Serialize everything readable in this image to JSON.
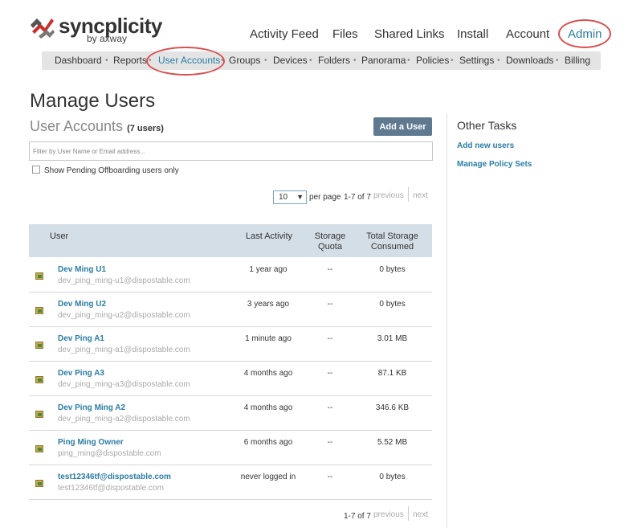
{
  "brand": {
    "name": "syncplicity",
    "sub": "by axway"
  },
  "topnav": {
    "activity_feed": "Activity Feed",
    "files": "Files",
    "shared_links": "Shared Links",
    "install": "Install",
    "account": "Account",
    "admin": "Admin"
  },
  "subnav": {
    "dashboard": "Dashboard",
    "reports": "Reports",
    "user_accounts": "User Accounts",
    "groups": "Groups",
    "devices": "Devices",
    "folders": "Folders",
    "panorama": "Panorama",
    "policies": "Policies",
    "settings": "Settings",
    "downloads": "Downloads",
    "billing": "Billing",
    "separator": "•"
  },
  "page": {
    "title": "Manage Users",
    "section_title": "User Accounts",
    "user_count": "(7 users)",
    "add_user_label": "Add a User",
    "filter_placeholder": "Filter by User Name or Email address...",
    "pending_label": "Show Pending Offboarding users only"
  },
  "pager": {
    "per_page_value": "10",
    "per_page_label": "per page",
    "range": "1-7 of 7",
    "previous": "previous",
    "next": "next"
  },
  "other_tasks": {
    "title": "Other Tasks",
    "add_new_users": "Add new users",
    "manage_policy_sets": "Manage Policy Sets"
  },
  "table": {
    "headers": {
      "user": "User",
      "last_activity": "Last Activity",
      "storage_quota_1": "Storage",
      "storage_quota_2": "Quota",
      "total_storage_1": "Total Storage",
      "total_storage_2": "Consumed"
    },
    "rows": [
      {
        "name": "Dev Ming U1",
        "email": "dev_ping_ming-u1@dispostable.com",
        "last_activity": "1 year ago",
        "quota": "--",
        "storage": "0 bytes"
      },
      {
        "name": "Dev Ming U2",
        "email": "dev_ping_ming-u2@dispostable.com",
        "last_activity": "3 years ago",
        "quota": "--",
        "storage": "0 bytes"
      },
      {
        "name": "Dev Ping A1",
        "email": "dev_ping_ming-a1@dispostable.com",
        "last_activity": "1 minute ago",
        "quota": "--",
        "storage": "3.01 MB"
      },
      {
        "name": "Dev Ping A3",
        "email": "dev_ping_ming-a3@dispostable.com",
        "last_activity": "4 months ago",
        "quota": "--",
        "storage": "87.1 KB"
      },
      {
        "name": "Dev Ping Ming A2",
        "email": "dev_ping_ming-a2@dispostable.com",
        "last_activity": "4 months ago",
        "quota": "--",
        "storage": "346.6 KB"
      },
      {
        "name": "Ping Ming Owner",
        "email": "ping_ming@dispostable.com",
        "last_activity": "6 months ago",
        "quota": "--",
        "storage": "5.52 MB"
      },
      {
        "name": "test12346tf@dispostable.com",
        "email": "test12346tf@dispostable.com",
        "last_activity": "never logged in",
        "quota": "--",
        "storage": "0 bytes"
      }
    ]
  },
  "colors": {
    "accent": "#2a7da5",
    "highlight_ring": "#d94f4f",
    "button": "#5f7a90",
    "table_header": "#d4dee6"
  }
}
